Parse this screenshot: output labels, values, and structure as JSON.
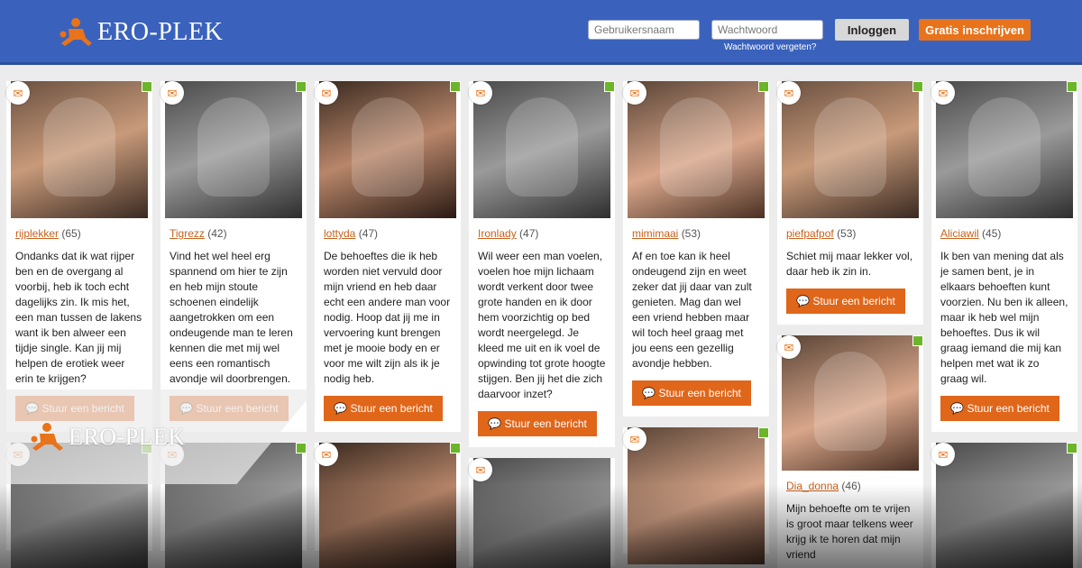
{
  "header": {
    "brand": "ERO-PLEK",
    "username_placeholder": "Gebruikersnaam",
    "password_placeholder": "Wachtwoord",
    "login_label": "Inloggen",
    "register_label": "Gratis inschrijven",
    "forgot_label": "Wachtwoord vergeten?"
  },
  "message_label": "Stuur een bericht",
  "overlay_brand": "ERO-PLEK",
  "profiles": [
    {
      "name": "rijplekker",
      "age": "(65)",
      "bio": "Ondanks dat ik wat rijper ben en de overgang al voorbij, heb ik toch echt dagelijks zin. Ik mis het, een man tussen de lakens want ik ben alweer een tijdje single. Kan jij mij helpen de erotiek weer erin te krijgen?"
    },
    {
      "name": "Tigrezz",
      "age": "(42)",
      "bio": "Vind het wel heel erg spannend om hier te zijn en heb mijn stoute schoenen eindelijk aangetrokken om een ondeugende man te leren kennen die met mij wel eens een romantisch avondje wil doorbrengen."
    },
    {
      "name": "lottyda",
      "age": "(47)",
      "bio": "De behoeftes die ik heb worden niet vervuld door mijn vriend en heb daar echt een andere man voor nodig. Hoop dat jij me in vervoering kunt brengen met je mooie body en er voor me wilt zijn als ik je nodig heb."
    },
    {
      "name": "Ironlady",
      "age": "(47)",
      "bio": "Wil weer een man voelen, voelen hoe mijn lichaam wordt verkent door twee grote handen en ik door hem voorzichtig op bed wordt neergelegd. Je kleed me uit en ik voel de opwinding tot grote hoogte stijgen. Ben jij het die zich daarvoor inzet?"
    },
    {
      "name": "mimimaai",
      "age": "(53)",
      "bio": "Af en toe kan ik heel ondeugend zijn en weet zeker dat jij daar van zult genieten. Mag dan wel een vriend hebben maar wil toch heel graag met jou eens een gezellig avondje hebben."
    },
    {
      "name": "piefpafpof",
      "age": "(53)",
      "bio": "Schiet mij maar lekker vol, daar heb ik zin in."
    },
    {
      "name": "Aliciawil",
      "age": "(45)",
      "bio": "Ik ben van mening dat als je samen bent, je in elkaars behoeften kunt voorzien. Nu ben ik alleen, maar ik heb wel mijn behoeftes. Dus ik wil graag iemand die mij kan helpen met wat ik zo graag wil."
    },
    {
      "name": "Dia_donna",
      "age": "(46)",
      "bio": "Mijn behoefte om te vrijen is groot maar telkens weer krijg ik te horen dat mijn vriend"
    }
  ]
}
